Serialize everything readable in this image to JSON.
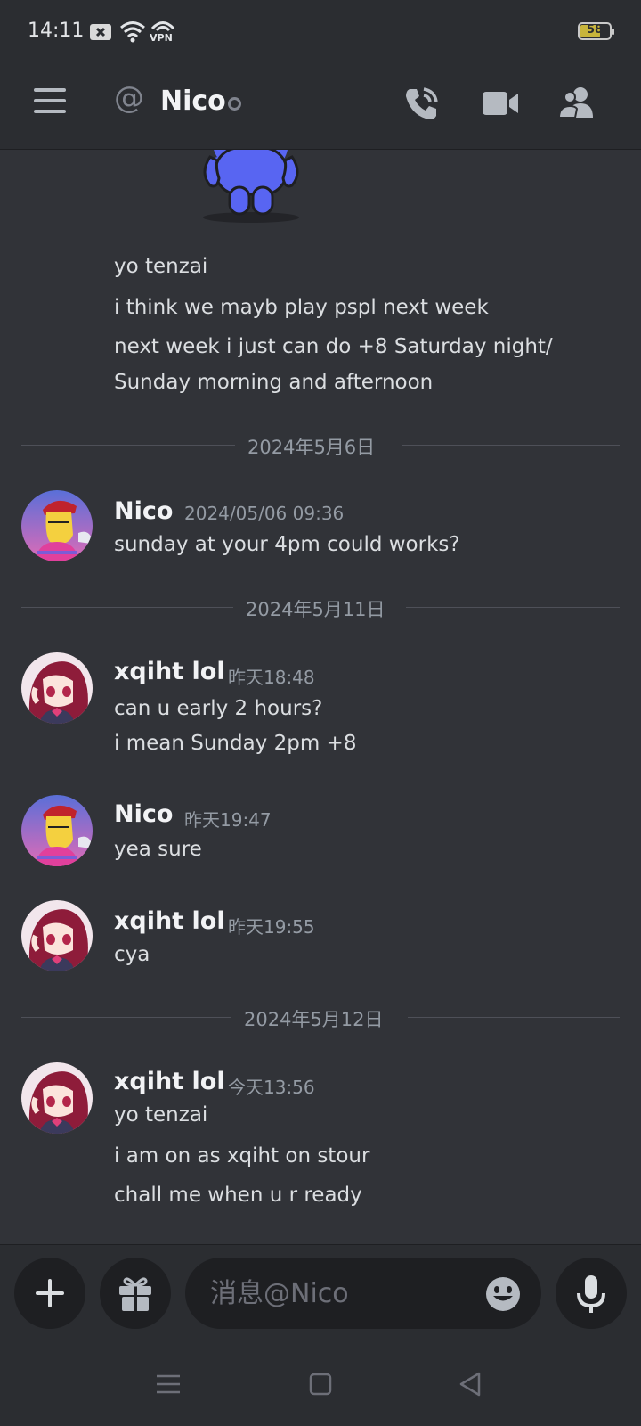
{
  "status_bar": {
    "time": "14:11",
    "vpn_label": "VPN",
    "battery_level": "58"
  },
  "header": {
    "channel_name": "Nico",
    "icons": [
      "menu-icon",
      "at-icon",
      "voice-call-icon",
      "video-call-icon",
      "members-icon"
    ]
  },
  "messages": {
    "top_lines": [
      "yo tenzai",
      "i think we mayb play pspl next week",
      "next week i just can do +8 Saturday night/",
      "Sunday morning and afternoon"
    ],
    "dividers": [
      "2024年5月6日",
      "2024年5月11日",
      "2024年5月12日"
    ],
    "groups": [
      {
        "author": "Nico",
        "timestamp": "2024/05/06 09:36",
        "lines": [
          "sunday at your 4pm could works?"
        ]
      },
      {
        "author": "xqiht lol",
        "timestamp": "昨天18:48",
        "lines": [
          "can u early 2 hours?",
          "i mean Sunday 2pm +8"
        ]
      },
      {
        "author": "Nico",
        "timestamp": "昨天19:47",
        "lines": [
          "yea sure"
        ]
      },
      {
        "author": "xqiht lol",
        "timestamp": "昨天19:55",
        "lines": [
          "cya"
        ]
      },
      {
        "author": "xqiht lol",
        "timestamp": "今天13:56",
        "lines": [
          "yo tenzai",
          "i am on as xqiht on stour",
          "chall me when u r ready"
        ]
      }
    ]
  },
  "composer": {
    "placeholder": "消息@Nico",
    "icons": [
      "plus-icon",
      "gift-icon",
      "emoji-icon",
      "microphone-icon"
    ]
  },
  "colors": {
    "background": "#313338",
    "bar": "#2b2d31",
    "text": "#dbdee1",
    "muted": "#949ba4",
    "accent_blue": "#5865f2"
  }
}
